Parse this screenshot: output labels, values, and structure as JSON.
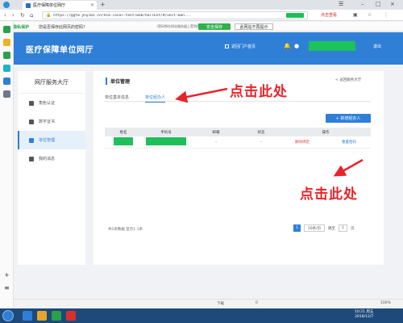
{
  "browser": {
    "tab_title": "医疗保障单位网厅",
    "url": "https://ggfw.ynyibz.cn/hsa-local-test/web/hallEnt/#/unit-man...",
    "red_link": "点击查看",
    "colors": {
      "accent": "#2f7fd7",
      "redact": "#1fbf5a",
      "annotation": "#e8232a"
    }
  },
  "notify": {
    "brand": "360 隐私保护",
    "message": "您是否保存此网页的密码？",
    "hint": "（密码将在网站服务器上受到保护）",
    "save_label": "安全保存",
    "never_label": "此网站不再提示"
  },
  "header": {
    "title": "医疗保障单位网厅",
    "portal_label": "返回门户首页",
    "logout_label": "退出"
  },
  "sidebar": {
    "title": "网厅服务大厅",
    "items": [
      {
        "label": "角色认证",
        "icon": "user-icon",
        "active": false
      },
      {
        "label": "数字证书",
        "icon": "certificate-icon",
        "active": false
      },
      {
        "label": "单位管理",
        "icon": "building-icon",
        "active": true
      },
      {
        "label": "我的消息",
        "icon": "mail-icon",
        "active": false
      }
    ]
  },
  "main": {
    "panel_title": "单位管理",
    "back_label": "< 返回服务大厅",
    "tabs": [
      "单位基本信息",
      "单位经办人"
    ],
    "active_tab": 1,
    "add_label": "+ 新增经办人",
    "columns": [
      "姓名",
      "手机号",
      "邮箱",
      "状态",
      "操作"
    ],
    "rows": [
      {
        "email": "-",
        "status": "-",
        "action_disable": "解除绑定",
        "action_edit": "重置密码"
      }
    ],
    "pager_info": "共1条数据 显示1-1条",
    "page_current": "1",
    "page_size": "10条/页",
    "goto_label": "跳至",
    "goto_value": "1",
    "goto_unit": "页"
  },
  "annotations": [
    "点击此处",
    "点击此处"
  ],
  "statusbar": {
    "item1": "下载",
    "item2": "0",
    "zoom": "100%"
  },
  "taskbar": {
    "time": "10:21 周五",
    "date": "2018/12/7"
  }
}
